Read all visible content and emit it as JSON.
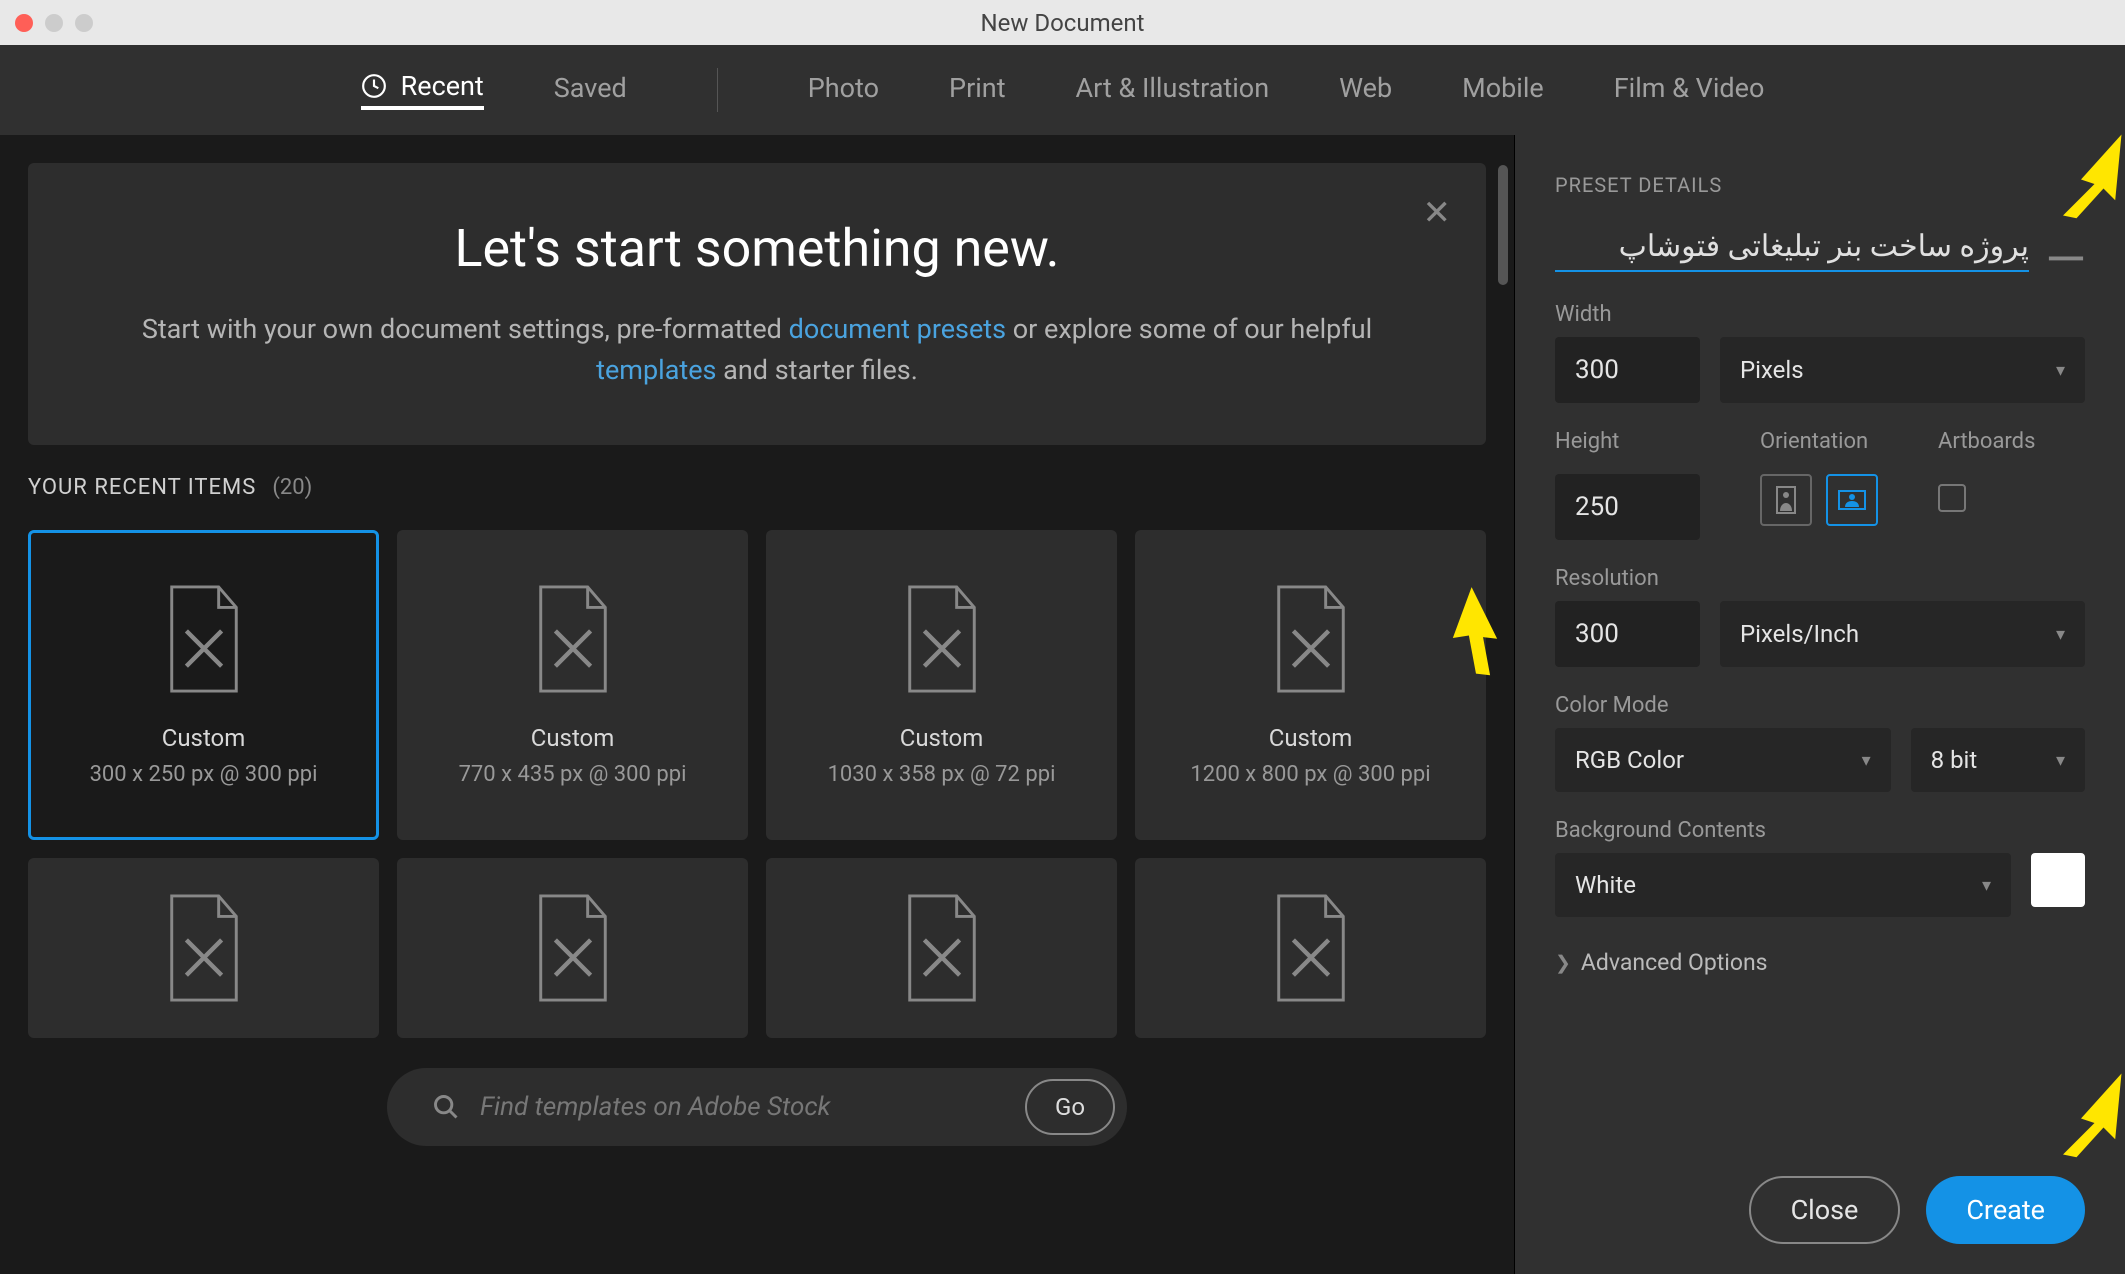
{
  "titlebar": {
    "title": "New Document"
  },
  "tabs": {
    "recent": "Recent",
    "saved": "Saved",
    "photo": "Photo",
    "print": "Print",
    "art": "Art & Illustration",
    "web": "Web",
    "mobile": "Mobile",
    "film": "Film & Video"
  },
  "hero": {
    "heading": "Let's start something new.",
    "line1a": "Start with your own document settings, pre-formatted ",
    "link1": "document presets",
    "line1b": " or explore some of our helpful ",
    "link2": "templates",
    "line1c": " and starter files."
  },
  "section": {
    "title": "YOUR RECENT ITEMS",
    "count": "(20)"
  },
  "cards": [
    {
      "name": "Custom",
      "dims": "300 x 250 px @ 300 ppi"
    },
    {
      "name": "Custom",
      "dims": "770 x 435 px @ 300 ppi"
    },
    {
      "name": "Custom",
      "dims": "1030 x 358 px @ 72 ppi"
    },
    {
      "name": "Custom",
      "dims": "1200 x 800 px @ 300 ppi"
    }
  ],
  "search": {
    "placeholder": "Find templates on Adobe Stock",
    "go": "Go"
  },
  "panel": {
    "title": "PRESET DETAILS",
    "name": "پروژه ساخت بنر تبلیغاتی فتوشاپ",
    "width_label": "Width",
    "width": "300",
    "units": "Pixels",
    "height_label": "Height",
    "height": "250",
    "orientation_label": "Orientation",
    "artboards_label": "Artboards",
    "resolution_label": "Resolution",
    "resolution": "300",
    "resolution_units": "Pixels/Inch",
    "colormode_label": "Color Mode",
    "colormode": "RGB Color",
    "bitdepth": "8 bit",
    "bg_label": "Background Contents",
    "bg": "White",
    "advanced": "Advanced Options",
    "close": "Close",
    "create": "Create"
  }
}
